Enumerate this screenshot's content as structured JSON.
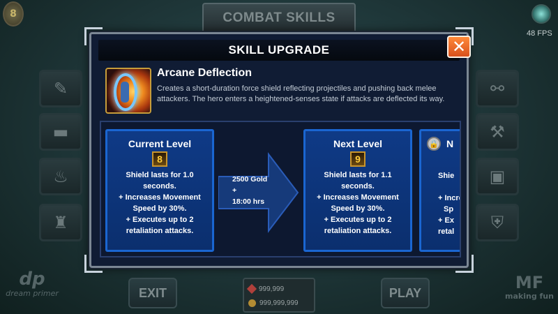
{
  "background": {
    "title": "COMBAT SKILLS",
    "fps": "48 FPS",
    "exit_label": "EXIT",
    "play_label": "PLAY",
    "gems": "999,999",
    "gold": "999,999,999",
    "left_logo": "dream primer",
    "right_logo": "making fun",
    "coin_glyph": "8"
  },
  "modal": {
    "title": "SKILL UPGRADE",
    "close_label": "✕",
    "skill": {
      "name": "Arcane Deflection",
      "description": "Creates a short-duration force shield reflecting projectiles and pushing back melee attackers. The hero enters a heightened-senses state if attacks are deflected its way."
    },
    "current": {
      "title": "Current Level",
      "level": "8",
      "lines": [
        "Shield lasts for 1.0",
        "seconds.",
        "+ Increases Movement",
        "Speed by 30%.",
        "+ Executes up to 2",
        "retaliation attacks."
      ]
    },
    "cost": {
      "line1": "2500 Gold",
      "line2": "+",
      "line3": "18:00 hrs"
    },
    "next": {
      "title": "Next Level",
      "level": "9",
      "lines": [
        "Shield lasts for 1.1",
        "seconds.",
        "+ Increases Movement",
        "Speed by 30%.",
        "+ Executes up to 2",
        "retaliation attacks."
      ]
    },
    "locked": {
      "title_partial": "N",
      "lines": [
        "Shie",
        "+ Incre",
        "Sp",
        "+ Ex",
        "retal"
      ]
    }
  },
  "colors": {
    "modal_bg": "#101c34",
    "card_border": "#1a66d1",
    "close_button": "#f06a28",
    "badge_text": "#ffcc3a"
  }
}
